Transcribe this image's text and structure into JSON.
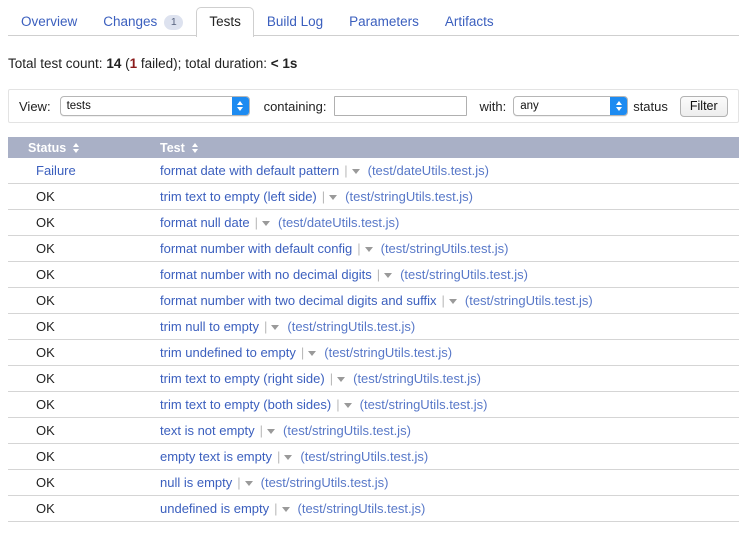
{
  "tabs": [
    {
      "label": "Overview",
      "active": false,
      "badge": null
    },
    {
      "label": "Changes",
      "active": false,
      "badge": "1"
    },
    {
      "label": "Tests",
      "active": true,
      "badge": null
    },
    {
      "label": "Build Log",
      "active": false,
      "badge": null
    },
    {
      "label": "Parameters",
      "active": false,
      "badge": null
    },
    {
      "label": "Artifacts",
      "active": false,
      "badge": null
    }
  ],
  "summary": {
    "count_label": "Total test count:",
    "count_value": "14",
    "failed_open": "(",
    "failed_value": "1",
    "failed_label": " failed);",
    "duration_label": "total duration:",
    "duration_value": "< 1s"
  },
  "filter": {
    "view_label": "View:",
    "view_value": "tests",
    "containing_label": "containing:",
    "containing_value": "",
    "containing_placeholder": "",
    "with_label": "with:",
    "status_value": "any",
    "status_label": "status",
    "filter_button": "Filter"
  },
  "table": {
    "columns": [
      {
        "label": "Status"
      },
      {
        "label": "Test"
      }
    ],
    "rows": [
      {
        "status": "Failure",
        "status_kind": "fail",
        "test": "format date with default pattern",
        "file": "(test/dateUtils.test.js)"
      },
      {
        "status": "OK",
        "status_kind": "ok",
        "test": "trim text to empty (left side)",
        "file": "(test/stringUtils.test.js)"
      },
      {
        "status": "OK",
        "status_kind": "ok",
        "test": "format null date",
        "file": "(test/dateUtils.test.js)"
      },
      {
        "status": "OK",
        "status_kind": "ok",
        "test": "format number with default config",
        "file": "(test/stringUtils.test.js)"
      },
      {
        "status": "OK",
        "status_kind": "ok",
        "test": "format number with no decimal digits",
        "file": "(test/stringUtils.test.js)"
      },
      {
        "status": "OK",
        "status_kind": "ok",
        "test": "format number with two decimal digits and suffix",
        "file": "(test/stringUtils.test.js)"
      },
      {
        "status": "OK",
        "status_kind": "ok",
        "test": "trim null to empty",
        "file": "(test/stringUtils.test.js)"
      },
      {
        "status": "OK",
        "status_kind": "ok",
        "test": "trim undefined to empty",
        "file": "(test/stringUtils.test.js)"
      },
      {
        "status": "OK",
        "status_kind": "ok",
        "test": "trim text to empty (right side)",
        "file": "(test/stringUtils.test.js)"
      },
      {
        "status": "OK",
        "status_kind": "ok",
        "test": "trim text to empty (both sides)",
        "file": "(test/stringUtils.test.js)"
      },
      {
        "status": "OK",
        "status_kind": "ok",
        "test": "text is not empty",
        "file": "(test/stringUtils.test.js)"
      },
      {
        "status": "OK",
        "status_kind": "ok",
        "test": "empty text is empty",
        "file": "(test/stringUtils.test.js)"
      },
      {
        "status": "OK",
        "status_kind": "ok",
        "test": "null is empty",
        "file": "(test/stringUtils.test.js)"
      },
      {
        "status": "OK",
        "status_kind": "ok",
        "test": "undefined is empty",
        "file": "(test/stringUtils.test.js)"
      }
    ]
  },
  "colors": {
    "link": "#3b5fbe",
    "header_bg": "#a9b0c6",
    "fail_red": "#8b1a1a",
    "stepper_blue": "#1d8bf1"
  }
}
